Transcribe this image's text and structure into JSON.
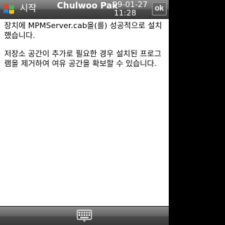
{
  "titlebar": {
    "start_label": "시작",
    "owner_name": "Chulwoo Pak",
    "date": "09-01-27",
    "time": "11:28",
    "ok_label": "ok"
  },
  "content": {
    "paragraphs": [
      "장치에 MPMServer.cab을(를) 성공적으로 설치했습니다.",
      "저장소 공간이 추가로 필요한 경우 설치된 프로그램을 제거하여 여유 공간을 확보할 수 있습니다."
    ]
  },
  "bottombar": {
    "sip_icon": "keyboard-icon"
  },
  "icons": {
    "start": "windows-flag-icon",
    "sip": "keyboard-icon"
  },
  "colors": {
    "titlebar": "#5a5a5a",
    "background": "#ffffff",
    "text": "#000000",
    "flag_red": "#e8402a",
    "flag_green": "#4cb84a",
    "flag_blue": "#2e7fd6",
    "flag_yellow": "#f4c020"
  }
}
